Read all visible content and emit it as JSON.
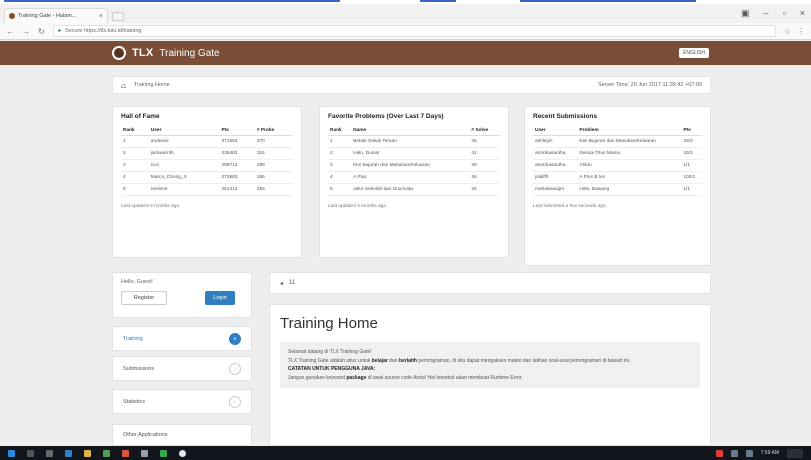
{
  "browser": {
    "tab_title": "Training Gate - Halam...",
    "address": "Secure  https://tlx.toki.id/training",
    "secure_label": "Secure"
  },
  "site": {
    "brand": "TLX",
    "brand_sub": "Training Gate",
    "language_button": "ENGLISH"
  },
  "breadcrumb": {
    "label": "Training Home",
    "server_time": "Server Time: 20 Jun 2017 11:39:42 +07:00"
  },
  "hall_of_fame": {
    "title": "Hall of Fame",
    "headers": [
      "Rank",
      "User",
      "Pts",
      "# Probs"
    ],
    "rows": [
      [
        "1",
        "andrewc",
        "371553",
        "370"
      ],
      [
        "2",
        "jackwerrith",
        "335463",
        "324"
      ],
      [
        "3",
        "ricci",
        "289713",
        "289"
      ],
      [
        "4",
        "Marco_Chong_X",
        "272883",
        "265"
      ],
      [
        "5",
        "revilone",
        "261313",
        "255"
      ]
    ],
    "footer": "Last updated 4 months ago"
  },
  "favorite_problems": {
    "title": "Favorite Problems (Over Last 7 Days)",
    "headers": [
      "Rank",
      "Name",
      "# Solve"
    ],
    "rows": [
      [
        "1",
        "Bebek Sekali Teman",
        "45"
      ],
      [
        "2",
        "Halo, Dunia!",
        "41"
      ],
      [
        "3",
        "Kini Bujuran dan Masukan/Keluaran",
        "38"
      ],
      [
        "4",
        "A Plus",
        "36"
      ],
      [
        "5",
        "Jalur Sekolah dan Dua Kata",
        "34"
      ]
    ],
    "footer": "Last updated 3 months ago"
  },
  "recent_submissions": {
    "title": "Recent Submissions",
    "headers": [
      "User",
      "Problem",
      "Pts"
    ],
    "rows": [
      [
        "ashleyin",
        "Kini Bujuran dan Masukan/Keluaran",
        "33/3"
      ],
      [
        "ammbasantha",
        "Sesuai Titus Mamu",
        "33/3"
      ],
      [
        "ammbasantha",
        "Ahlan",
        "1/1"
      ],
      [
        "jsaliffh",
        "A Plus B lus",
        "100/1"
      ],
      [
        "mahasiswajm",
        "Halo, Bawang",
        "1/1"
      ]
    ],
    "footer": "Last submitted a few seconds ago"
  },
  "guest_box": {
    "label": "Hello, Guest!",
    "register_label": "Register",
    "login_label": "Login"
  },
  "menu": [
    {
      "label": "Training",
      "badge": "0",
      "active": true
    },
    {
      "label": "Submissions",
      "badge": "",
      "active": false
    },
    {
      "label": "Statistics",
      "badge": "",
      "active": false
    },
    {
      "label": "Other Applications",
      "badge": "",
      "active": false
    }
  ],
  "pager": {
    "arrow": "◂",
    "value": "11"
  },
  "main": {
    "title": "Training Home",
    "welcome": "Selamat datang di TLX Training Gate!",
    "desc_pre": "TLX Training Gate adalah situs untuk ",
    "desc_b1": "belajar",
    "desc_mid": " dan ",
    "desc_b2": "berlatih",
    "desc_post": " pemrograman, di situ dapat mengakses materi dan latihan soal-soal pemrograman di bawah ini.",
    "note_title": "CATATAN UNTUK PENGGUNA JAVA:",
    "note_pre": "Jangan gunakan keyword ",
    "note_b": "package",
    "note_post": " di awal source code Anda! Hal tersebut akan membuat Runtime Error."
  },
  "taskbar": {
    "clock": "7:59 AM"
  },
  "colors": {
    "header_brown": "#7a4e36",
    "accent_blue": "#2f7fc1"
  }
}
